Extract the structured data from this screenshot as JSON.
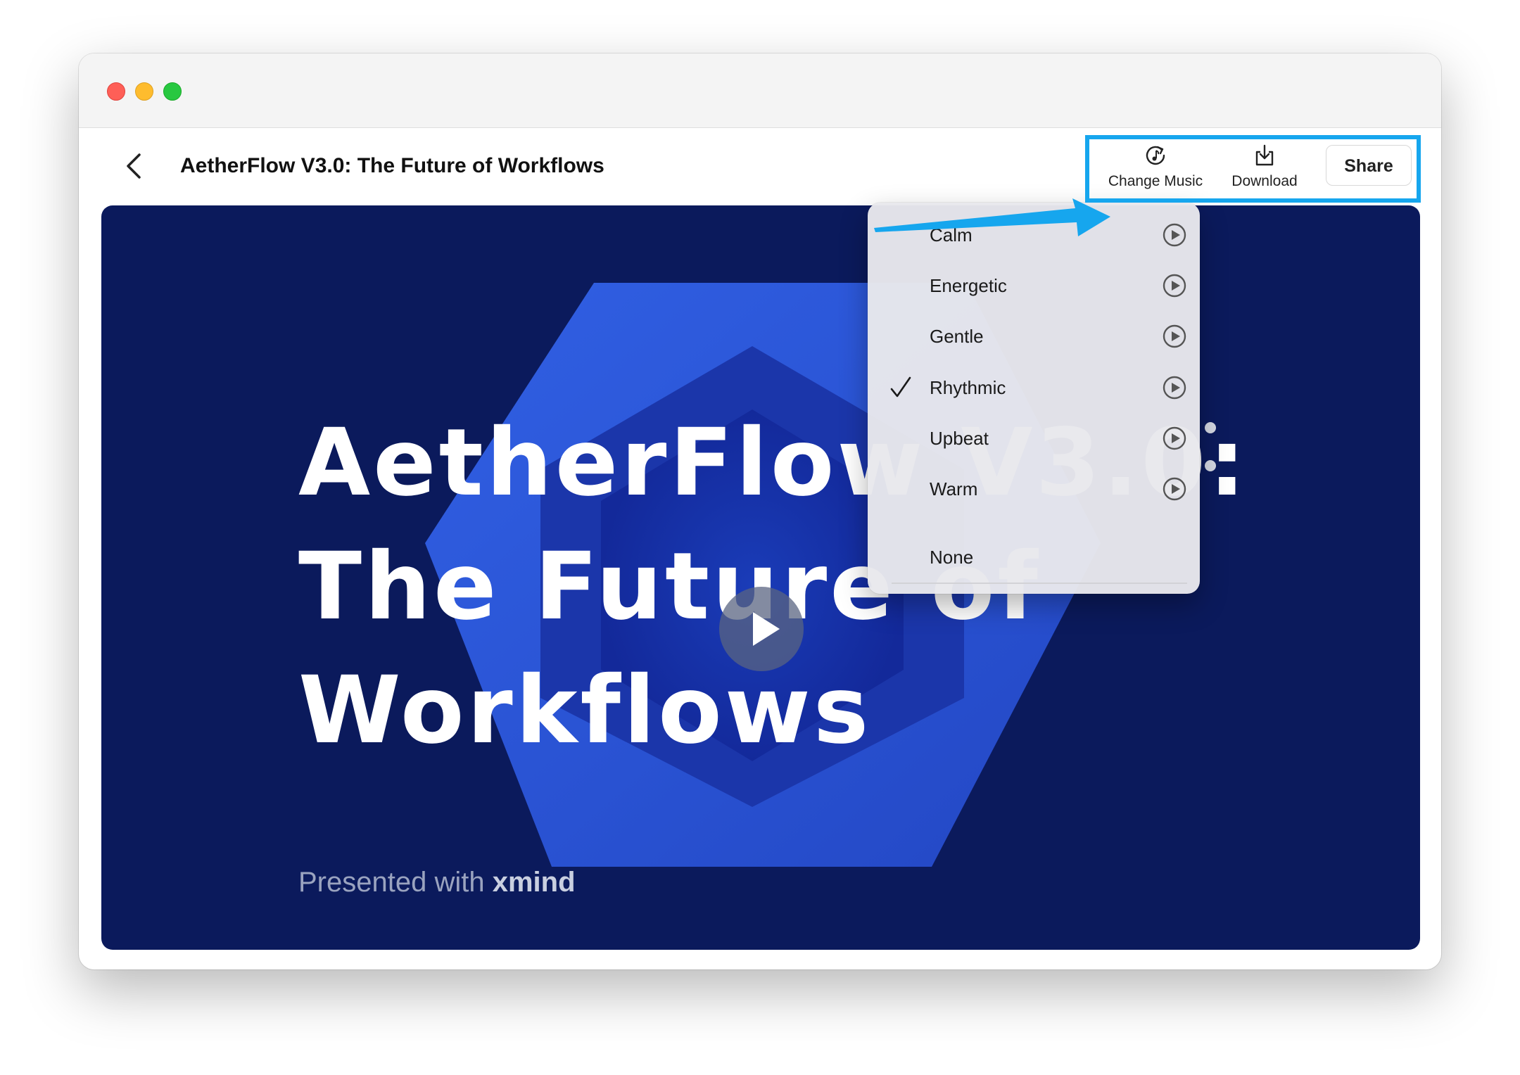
{
  "window": {
    "title": "AetherFlow V3.0: The Future of Workflows"
  },
  "toolbar": {
    "change_music_label": "Change Music",
    "download_label": "Download",
    "share_label": "Share"
  },
  "stage": {
    "hero_line1": "AetherFlow V3.0:",
    "hero_line2": "The Future of",
    "hero_line3": "Workflows",
    "presented_prefix": "Presented with",
    "presented_brand": "xmind"
  },
  "music_menu": {
    "selected": "Rhythmic",
    "items": [
      {
        "label": "Calm"
      },
      {
        "label": "Energetic"
      },
      {
        "label": "Gentle"
      },
      {
        "label": "Rhythmic"
      },
      {
        "label": "Upbeat"
      },
      {
        "label": "Warm"
      }
    ],
    "none_label": "None"
  },
  "colors": {
    "stage_bg": "#0b1a5c",
    "hex_blue": "#2f5ce0",
    "highlight": "#16a6ee"
  }
}
